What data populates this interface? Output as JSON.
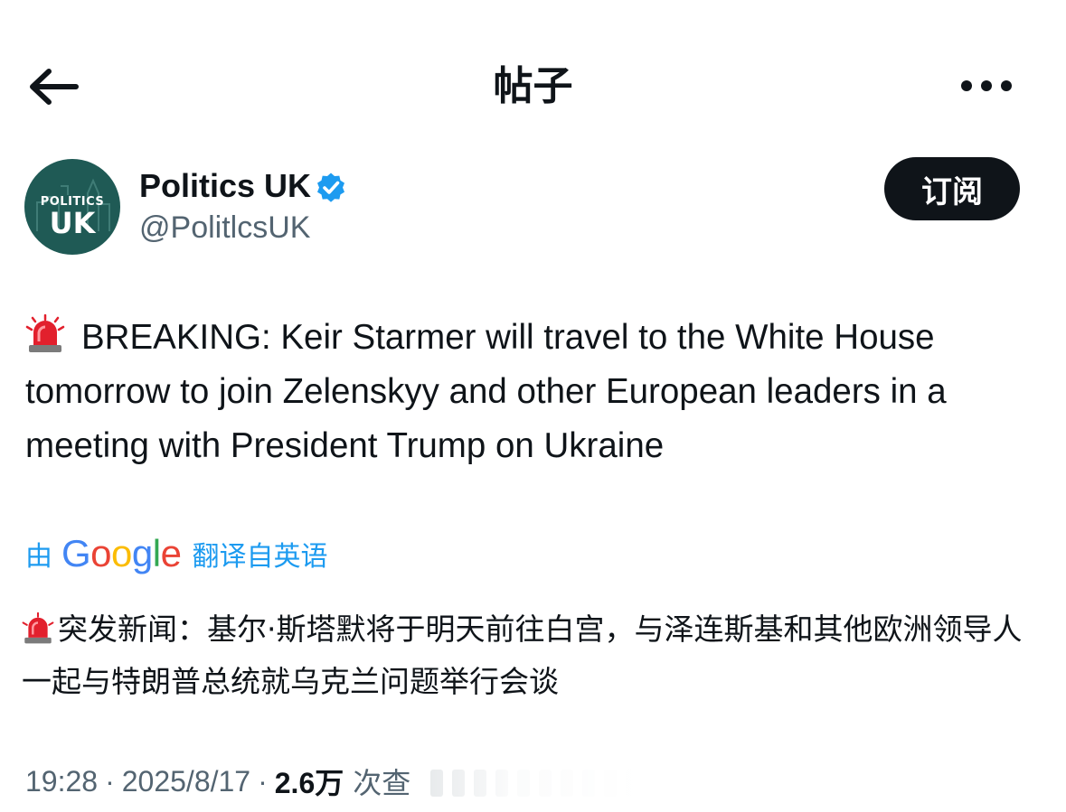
{
  "header": {
    "title": "帖子",
    "back_icon": "arrow-left-icon",
    "more_icon": "more-horizontal-icon"
  },
  "author": {
    "name": "Politics UK",
    "handle": "@PolitlcsUK",
    "avatar": {
      "line1": "POLITICS",
      "line2": "UK",
      "bg_color": "#1f5a55"
    },
    "verified_icon": "verified-badge-icon",
    "verified_color": "#1d9bf0"
  },
  "subscribe_button": {
    "label": "订阅"
  },
  "tweet": {
    "emoji_icon": "rotating-light-icon",
    "text": "BREAKING: Keir Starmer will travel to the White House tomorrow to join Zelenskyy and other European leaders in a meeting with President Trump on Ukraine"
  },
  "translation": {
    "by_label": "由",
    "provider": "Google",
    "suffix_label": "翻译自英语",
    "text": "突发新闻：基尔·斯塔默将于明天前往白宫，与泽连斯基和其他欧洲领导人一起与特朗普总统就乌克兰问题举行会谈"
  },
  "meta": {
    "time": "19:28",
    "separator": "·",
    "date": "2025/8/17",
    "views_count": "2.6万",
    "views_label": "次查"
  },
  "colors": {
    "text": "#0f1419",
    "secondary": "#536471",
    "link": "#1d9bf0",
    "button_bg": "#0f1419"
  }
}
